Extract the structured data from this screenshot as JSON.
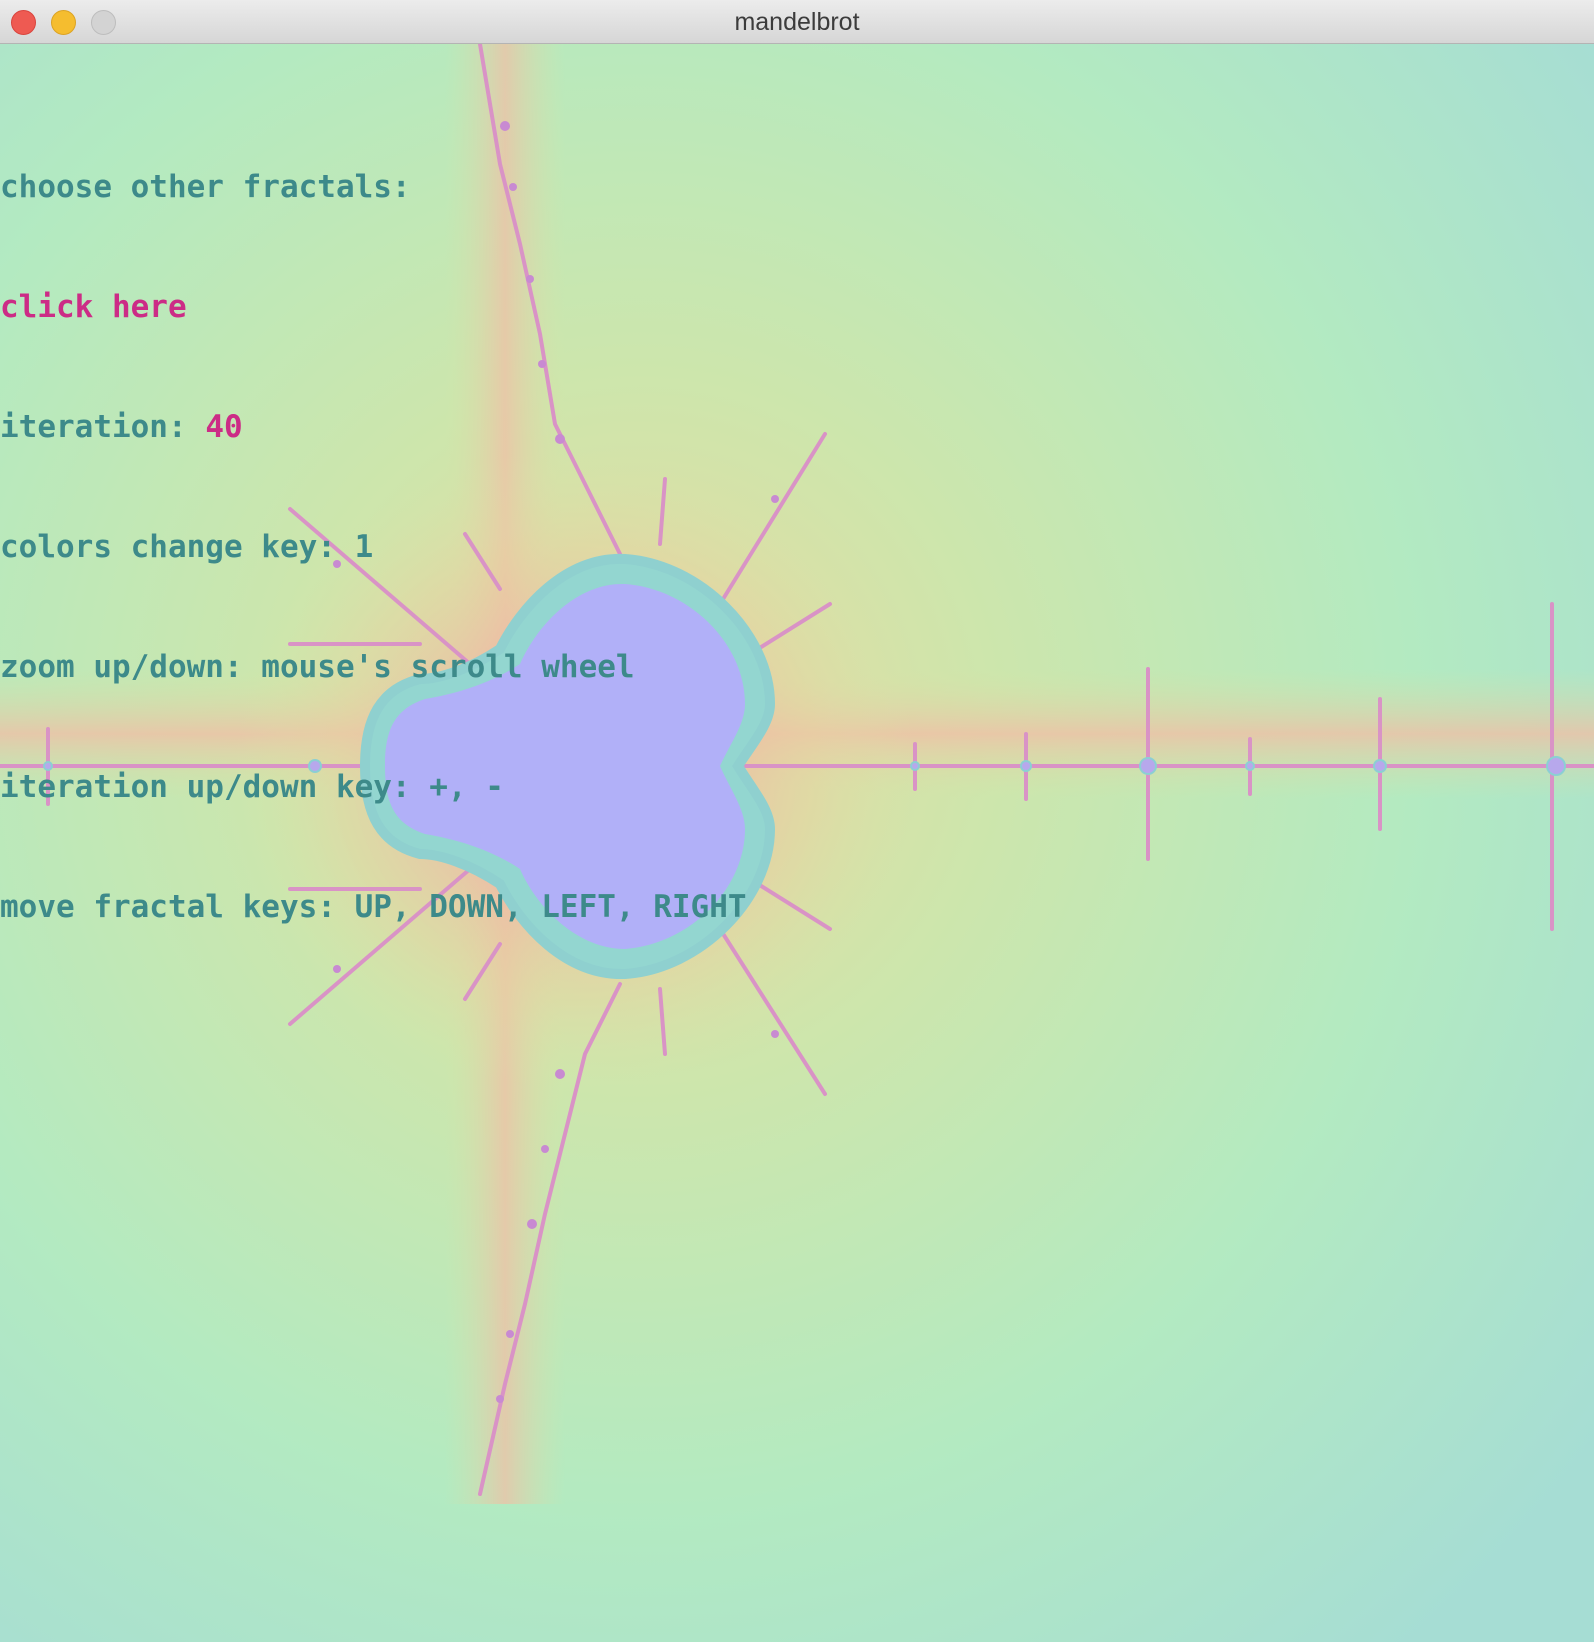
{
  "window": {
    "title": "mandelbrot"
  },
  "info": {
    "choose_label": "choose other fractals:",
    "click_here": "click here",
    "iteration_label": "iteration: ",
    "iteration_value": "40",
    "colors_key": "colors change key: 1",
    "zoom_help": "zoom up/down: mouse's scroll wheel",
    "iteration_keys": "iteration up/down key: +, -",
    "move_keys": "move fractal keys: UP, DOWN, LEFT, RIGHT"
  },
  "colors": {
    "text": "#3d8a8a",
    "highlight": "#cc2c86",
    "set_interior": "#b1b0f8",
    "background": "#b2e8c4"
  }
}
